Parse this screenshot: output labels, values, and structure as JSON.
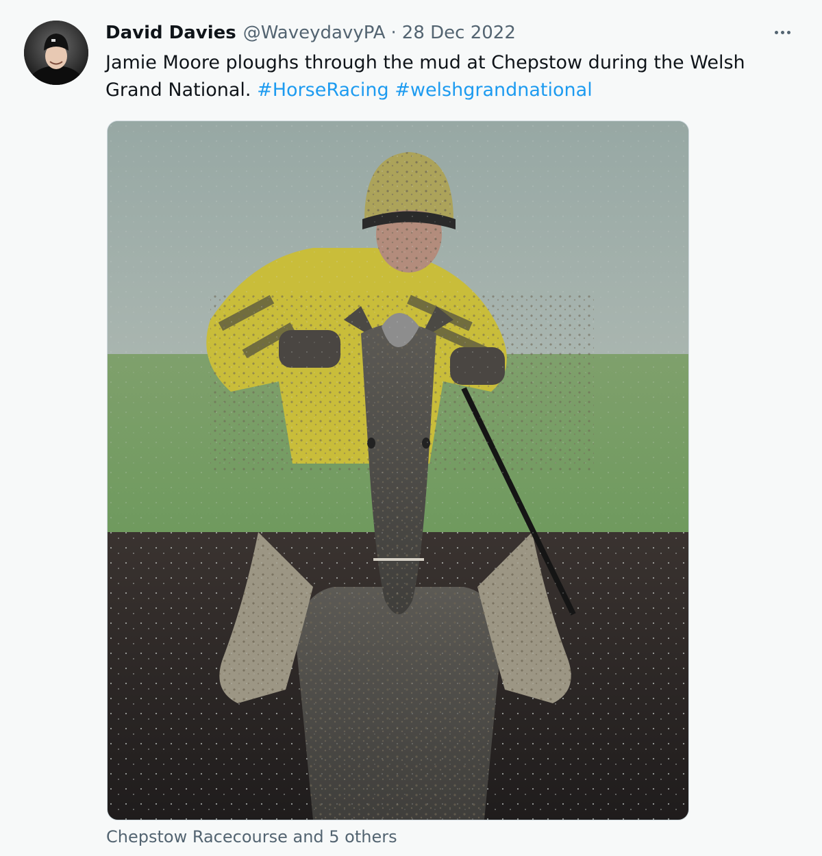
{
  "tweet": {
    "author_name": "David Davies",
    "author_handle": "@WaveydavyPA",
    "separator": "·",
    "date": "28 Dec 2022",
    "text_main": "Jamie Moore ploughs through the mud at Chepstow during the Welsh Grand National.",
    "hashtags": [
      "#HorseRacing",
      "#welshgrandnational"
    ],
    "tagged_text": "Chepstow Racecourse and 5 others",
    "more_icon": "more-horizontal-icon"
  },
  "colors": {
    "background": "#f7f9f9",
    "text_primary": "#0f1419",
    "text_secondary": "#536471",
    "link": "#1d9bf0"
  }
}
